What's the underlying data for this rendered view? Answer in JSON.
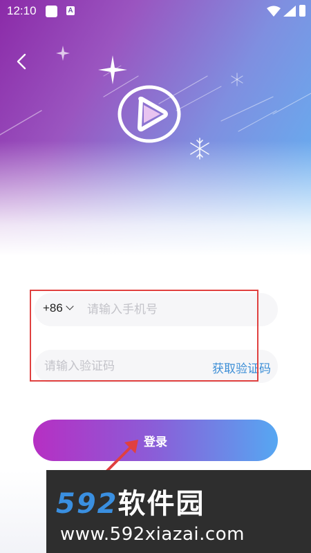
{
  "status_bar": {
    "time": "12:10",
    "notif_icon_label": "A"
  },
  "icons": {
    "back": "back-chevron-icon",
    "logo": "play-icon",
    "sparkles": "sparkle-icon",
    "snowflakes": "snowflake-icon"
  },
  "form": {
    "country_code": "+86",
    "phone_placeholder": "请输入手机号",
    "code_placeholder": "请输入验证码",
    "get_code": "获取验证码"
  },
  "login_label": "登录",
  "watermark": {
    "brand_numbers": "592",
    "brand_cn": "软件园",
    "url": "www.592xiazai.com"
  },
  "colors": {
    "accent_blue": "#3c8ed6",
    "highlight_red": "#e0403f",
    "gradient_start": "#b62fc3",
    "gradient_end": "#56a7f2"
  }
}
